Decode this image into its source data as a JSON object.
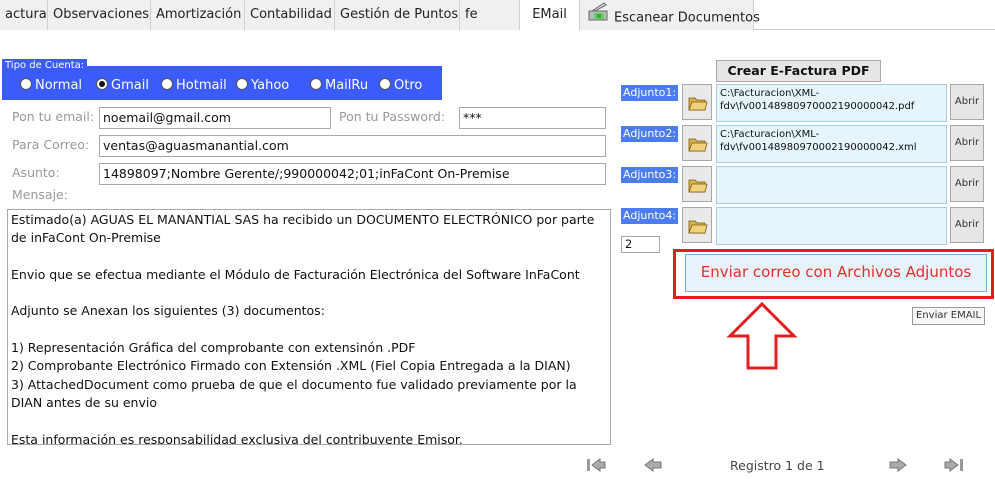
{
  "tabs": [
    {
      "label": "actura",
      "active": false
    },
    {
      "label": "Observaciones",
      "active": false
    },
    {
      "label": "Amortización",
      "active": false
    },
    {
      "label": "Contabilidad",
      "active": false
    },
    {
      "label": "Gestión de Puntos",
      "active": false
    },
    {
      "label": "fe",
      "active": false
    },
    {
      "label": "EMail",
      "active": true
    },
    {
      "label": "Escanear Documentos",
      "active": false
    }
  ],
  "account": {
    "legend": "Tipo de Cuenta:",
    "options": [
      "Normal",
      "Gmail",
      "Hotmail",
      "Yahoo",
      "MailRu",
      "Otro"
    ],
    "selected": "Gmail"
  },
  "form": {
    "email_label": "Pon tu email:",
    "email_value": "noemail@gmail.com",
    "password_label": "Pon tu Password:",
    "password_value": "***",
    "to_label": "Para Correo:",
    "to_value": "ventas@aguasmanantial.com",
    "subject_label": "Asunto:",
    "subject_value": "14898097;Nombre Gerente/;990000042;01;inFaCont On-Premise",
    "message_label": "Mensaje:",
    "message_value": "Estimado(a) AGUAS EL MANANTIAL SAS ha recibido un DOCUMENTO ELECTRÓNICO por parte\nde inFaCont On-Premise\n\nEnvio que se efectua mediante el Módulo de Facturación Electrónica del Software InFaCont\n\nAdjunto se Anexan los siguientes (3) documentos:\n\n1) Representación Gráfica del comprobante con extensinón .PDF\n2) Comprobante Electrónico Firmado con Extensión .XML (Fiel Copia Entregada a la DIAN)\n3) AttachedDocument como prueba de que el documento fue validado previamente por la\nDIAN antes de su envio\n\nEsta información es responsabilidad exclusiva del contribuyente Emisor."
  },
  "attachments": {
    "create_pdf_label": "Crear E-Factura PDF",
    "items": [
      {
        "label": "Adjunto1:",
        "path": "C:\\Facturacion\\XML-\nfdv\\fv00148980970002190000042.pdf",
        "open_label": "Abrir"
      },
      {
        "label": "Adjunto2:",
        "path": "C:\\Facturacion\\XML-\nfdv\\fv00148980970002190000042.xml",
        "open_label": "Abrir"
      },
      {
        "label": "Adjunto3:",
        "path": "",
        "open_label": "Abrir"
      },
      {
        "label": "Adjunto4:",
        "path": "",
        "open_label": "Abrir"
      }
    ],
    "count": "2",
    "send_label": "Enviar correo con Archivos Adjuntos",
    "tooltip": "Enviar EMAIL"
  },
  "nav": {
    "record_label": "Registro 1 de 1"
  },
  "colors": {
    "group_bg": "#3b5bfa",
    "label_bg": "#4b7cf0",
    "send_text": "#e0302a",
    "highlight": "#e02020"
  }
}
